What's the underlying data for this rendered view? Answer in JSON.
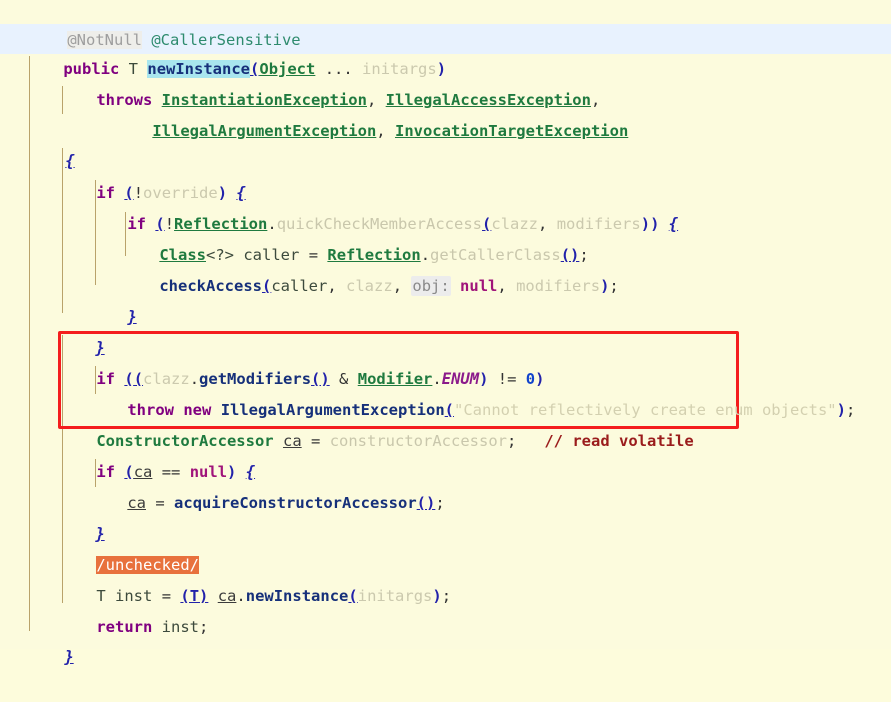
{
  "editor": {
    "background_color": "#fcfbdd",
    "current_line_color": "#e8f2fe",
    "indent_guide_color": "#b9a26a",
    "highlight_box_color": "#f41d1d"
  },
  "annotations_line": {
    "not_null": "@NotNull",
    "caller_sensitive": "@CallerSensitive"
  },
  "signature": {
    "modifier": "public",
    "type_param": "T",
    "method_name": "newInstance",
    "open_paren": "(",
    "param_type": "Object",
    "varargs": "...",
    "param_name": "initargs",
    "close_paren": ")"
  },
  "throws_clause": {
    "keyword": "throws",
    "exceptions_line1": [
      "InstantiationException",
      "IllegalAccessException"
    ],
    "exceptions_line2": [
      "IllegalArgumentException",
      "InvocationTargetException"
    ],
    "comma": ","
  },
  "body": {
    "open_brace": "{",
    "close_brace": "}",
    "if_keyword": "if",
    "not_operator": "!",
    "override_ident": "override",
    "reflection_class": "Reflection",
    "dot": ".",
    "quick_check_method": "quickCheckMemberAccess",
    "clazz_ident": "clazz",
    "modifiers_ident": "modifiers",
    "class_type": "Class",
    "generic_wildcard": "<?>",
    "caller_ident": "caller",
    "assign": "=",
    "get_caller_class_method": "getCallerClass",
    "empty_args": "()",
    "check_access_method": "checkAccess",
    "obj_param_hint": "obj:",
    "null_keyword": "null",
    "semicolon": ";",
    "get_modifiers_method": "getModifiers",
    "bitwise_and": "&",
    "modifier_class": "Modifier",
    "enum_constant": "ENUM",
    "not_equals": "!=",
    "zero": "0",
    "throw_keyword": "throw",
    "new_keyword": "new",
    "illegal_arg_exception": "IllegalArgumentException",
    "enum_message": "\"Cannot reflectively create enum objects\"",
    "ctor_accessor_type": "ConstructorAccessor",
    "ca_ident": "ca",
    "ctor_accessor_field": "constructorAccessor",
    "read_volatile_comment": "// read volatile",
    "equals_equals": "==",
    "acquire_method": "acquireConstructorAccessor",
    "unchecked_marker": "/unchecked/",
    "inst_ident": "inst",
    "cast_t": "(T)",
    "new_instance_method": "newInstance",
    "initargs_ident": "initargs",
    "return_keyword": "return",
    "t_type": "T"
  }
}
